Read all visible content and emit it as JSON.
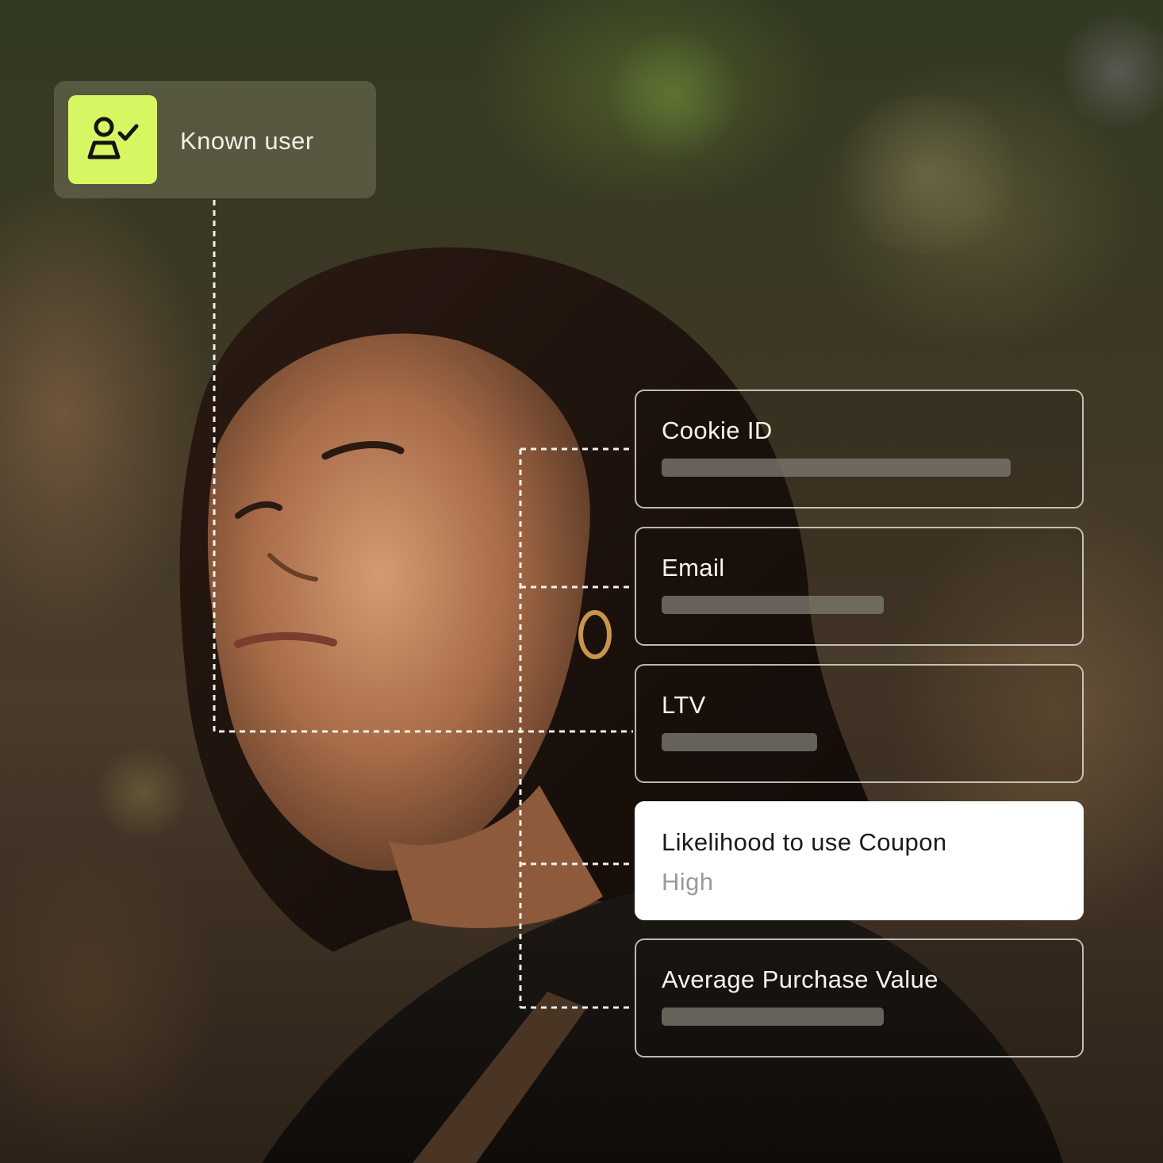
{
  "identity": {
    "icon": "user-check-icon",
    "label": "Known user",
    "icon_color": "#d6f762"
  },
  "attributes": [
    {
      "label": "Cookie ID",
      "value": null,
      "redacted": true
    },
    {
      "label": "Email",
      "value": null,
      "redacted": true
    },
    {
      "label": "LTV",
      "value": null,
      "redacted": true
    },
    {
      "label": "Likelihood to use Coupon",
      "value": "High",
      "redacted": false,
      "highlighted": true
    },
    {
      "label": "Average Purchase Value",
      "value": null,
      "redacted": true
    }
  ]
}
